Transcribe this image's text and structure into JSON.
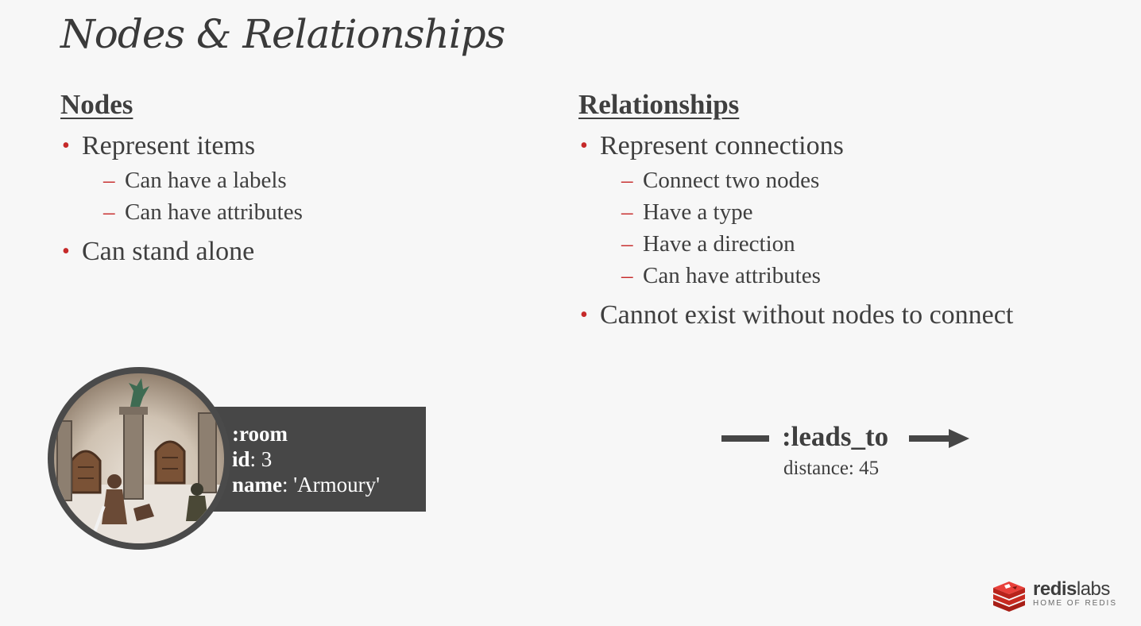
{
  "title": "Nodes & Relationships",
  "nodes_section": {
    "heading": "Nodes",
    "bullets": [
      {
        "text": "Represent items",
        "subs": [
          "Can have a labels",
          "Can have attributes"
        ]
      },
      {
        "text": "Can stand alone",
        "subs": []
      }
    ]
  },
  "relationships_section": {
    "heading": "Relationships",
    "bullets": [
      {
        "text": "Represent connections",
        "subs": [
          "Connect two nodes",
          "Have a type",
          "Have a direction",
          "Can have attributes"
        ]
      },
      {
        "text": "Cannot exist without nodes to connect",
        "subs": []
      }
    ]
  },
  "node_example": {
    "label": ":room",
    "id_key": "id",
    "id_value": ": 3",
    "name_key": "name",
    "name_value": ": 'Armoury'"
  },
  "relationship_example": {
    "type": ":leads_to",
    "attribute": "distance: 45"
  },
  "logo": {
    "brand_bold": "redis",
    "brand_light": "labs",
    "tagline": "HOME OF REDIS"
  },
  "colors": {
    "bullet_accent": "#c62a2a",
    "node_box": "#474747",
    "logo_red": "#d82c20"
  }
}
